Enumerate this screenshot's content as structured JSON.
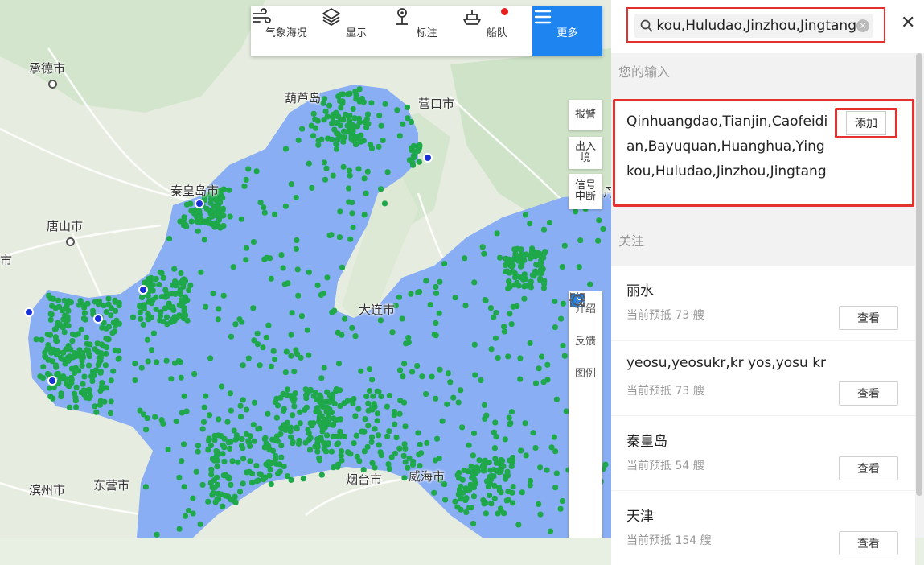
{
  "map": {
    "cities": [
      "承德市",
      "葫芦岛",
      "营口市",
      "秦皇岛市",
      "唐山市",
      "市",
      "大连市",
      "滨州市",
      "东营市",
      "烟台市",
      "威海市",
      "丹"
    ]
  },
  "toolbar": {
    "items": [
      {
        "label": "气象海况",
        "icon": "wind-icon"
      },
      {
        "label": "显示",
        "icon": "layers-icon"
      },
      {
        "label": "标注",
        "icon": "map-pin-icon"
      },
      {
        "label": "船队",
        "icon": "ship-icon"
      },
      {
        "label": "更多",
        "icon": "menu-icon"
      }
    ]
  },
  "side_buttons": {
    "alarm": "报警",
    "entry_exit": "出入境",
    "signal_loss": "信号中断",
    "intro": "介绍",
    "feedback": "反馈",
    "legend": "图例"
  },
  "search": {
    "value": "Qinhuangdao,Tianjin,Caofeidian,Bayuquan,Huanghua,Yingkou,Huludao,Jinzhou,Jingtang",
    "clear_icon": "×",
    "close_icon": "✕"
  },
  "your_input": {
    "label": "您的输入",
    "text": "Qinhuangdao,Tianjin,Caofeidian,Bayuquan,Huanghua,Yingkou,Huludao,Jinzhou,Jingtang",
    "add_label": "添加"
  },
  "follow": {
    "label": "关注",
    "items": [
      {
        "name": "丽水",
        "sub": "当前预抵 73 艘",
        "button": "查看"
      },
      {
        "name": "yeosu,yeosukr,kr yos,yosu kr",
        "sub": "当前预抵 73 艘",
        "button": "查看"
      },
      {
        "name": "秦皇岛",
        "sub": "当前预抵 54 艘",
        "button": "查看"
      },
      {
        "name": "天津",
        "sub": "当前预抵 154 艘",
        "button": "查看"
      }
    ]
  },
  "colors": {
    "sea": "#8aaef3",
    "ship": "#1fa84a",
    "accent": "#1d84f0",
    "highlight": "#e53030"
  }
}
